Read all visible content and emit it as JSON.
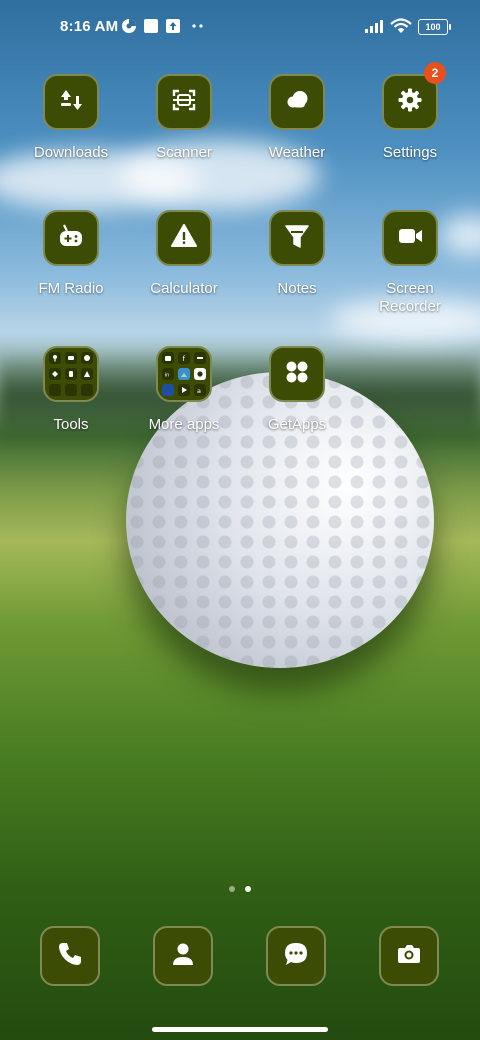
{
  "status_bar": {
    "time": "8:16 AM",
    "battery": "100",
    "icons": [
      "data-saver-icon",
      "notification-square-icon",
      "upload-icon",
      "more-dots-icon",
      "signal-icon",
      "wifi-icon",
      "battery-icon"
    ]
  },
  "home_grid": {
    "row1": [
      {
        "label": "Downloads",
        "icon": "download-arrows-icon"
      },
      {
        "label": "Scanner",
        "icon": "scanner-icon"
      },
      {
        "label": "Weather",
        "icon": "cloud-icon"
      },
      {
        "label": "Settings",
        "icon": "gear-icon",
        "badge": "2"
      }
    ],
    "row2": [
      {
        "label": "FM Radio",
        "icon": "radio-icon"
      },
      {
        "label": "Calculator",
        "icon": "warning-triangle-icon"
      },
      {
        "label": "Notes",
        "icon": "funnel-icon"
      },
      {
        "label": "Screen\nRecorder",
        "icon": "video-camera-icon"
      }
    ],
    "row3": [
      {
        "label": "Tools",
        "icon": "folder-icon"
      },
      {
        "label": "More apps",
        "icon": "folder-icon"
      },
      {
        "label": "GetApps",
        "icon": "four-dots-icon"
      }
    ]
  },
  "page_indicator": {
    "pages": 2,
    "active": 2
  },
  "dock": [
    {
      "name": "phone",
      "icon": "phone-icon"
    },
    {
      "name": "contacts",
      "icon": "person-icon"
    },
    {
      "name": "messages",
      "icon": "chat-bubble-icon"
    },
    {
      "name": "camera",
      "icon": "camera-icon"
    }
  ],
  "colors": {
    "tile_bg": "#3d4c05",
    "tile_border": "#7f8a53",
    "badge": "#e8501d"
  }
}
